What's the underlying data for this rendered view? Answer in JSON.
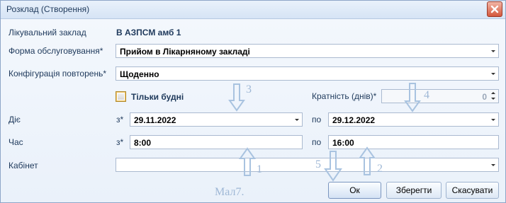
{
  "window": {
    "title": "Розклад (Створення)"
  },
  "form": {
    "facility_label": "Лікувальний заклад",
    "facility_value": "В АЗПСМ амб 1",
    "service_form_label": "Форма обслуговування*",
    "service_form_value": "Прийом в Лікарняному закладі",
    "repeat_config_label": "Конфігурація повторень*",
    "repeat_config_value": "Щоденно",
    "weekdays_only_label": "Тільки будні",
    "weekdays_only_checked": false,
    "multiplicity_label": "Кратність (днів)*",
    "multiplicity_value": "0",
    "valid_label": "Діє",
    "from_label": "з*",
    "from_date": "29.11.2022",
    "to_label": "по",
    "to_date": "29.12.2022",
    "time_label": "Час",
    "time_from_label": "з*",
    "time_from": "8:00",
    "time_to_label": "по",
    "time_to": "16:00",
    "cabinet_label": "Кабінет",
    "cabinet_value": ""
  },
  "buttons": {
    "ok": "Ок",
    "save": "Зберегти",
    "cancel": "Скасувати"
  },
  "annotations": {
    "n1": "1",
    "n2": "2",
    "n3": "3",
    "n4": "4",
    "n5": "5",
    "caption": "Мал7."
  }
}
